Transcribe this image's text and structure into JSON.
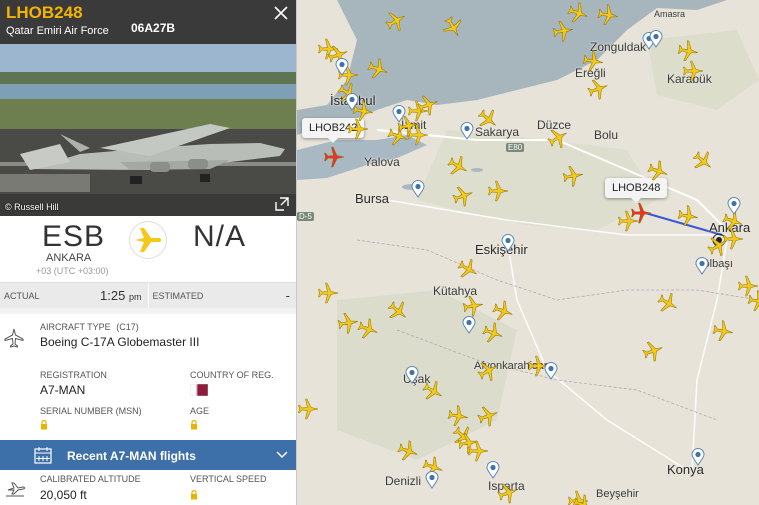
{
  "header": {
    "callsign": "LHOB248",
    "airline": "Qatar Emiri Air Force",
    "registration_code": "06A27B"
  },
  "photo": {
    "credit": "© Russell Hill"
  },
  "route": {
    "origin_code": "ESB",
    "origin_city": "ANKARA",
    "origin_tz": "+03 (UTC +03:00)",
    "destination_code": "N/A"
  },
  "times": {
    "actual_label": "ACTUAL",
    "actual_value": "1:25",
    "actual_suffix": "pm",
    "estimated_label": "ESTIMATED",
    "estimated_value": "-"
  },
  "aircraft": {
    "type_label": "AIRCRAFT TYPE",
    "type_code": "(C17)",
    "type_value": "Boeing C-17A Globemaster III",
    "registration_label": "REGISTRATION",
    "registration_value": "A7-MAN",
    "country_label": "COUNTRY OF REG.",
    "serial_label": "SERIAL NUMBER (MSN)",
    "age_label": "AGE"
  },
  "recent": {
    "label": "Recent A7-MAN flights"
  },
  "altitude": {
    "cal_label": "CALIBRATED ALTITUDE",
    "cal_value": "20,050 ft",
    "vs_label": "VERTICAL SPEED"
  },
  "map": {
    "cities": {
      "amasra": "Amasra",
      "zonguldak": "Zonguldak",
      "eregli": "Ereğli",
      "karabuk": "Karabük",
      "istanbul": "İstanbul",
      "izmit": "İzmit",
      "sakarya": "Sakarya",
      "duzce": "Düzce",
      "bolu": "Bolu",
      "yalova": "Yalova",
      "bursa": "Bursa",
      "eskisehir": "Eskişehir",
      "ankara": "Ankara",
      "golbasi": "Gölbaşı",
      "kutahya": "Kütahya",
      "usak": "Uşak",
      "afyon": "Afyonkarahisar",
      "konya": "Konya",
      "denizli": "Denizli",
      "isparta": "Isparta",
      "beysehir": "Beyşehir"
    },
    "road_e80": "E80",
    "road_d5": "D-5",
    "labels": {
      "selected": "LHOB248",
      "other": "LHOB242"
    },
    "colors": {
      "plane": "#f3c91a",
      "selected_plane": "#e8342a",
      "track": "#3a57d8",
      "sea": "#a9b9c4",
      "land": "#e7e3d8"
    }
  }
}
